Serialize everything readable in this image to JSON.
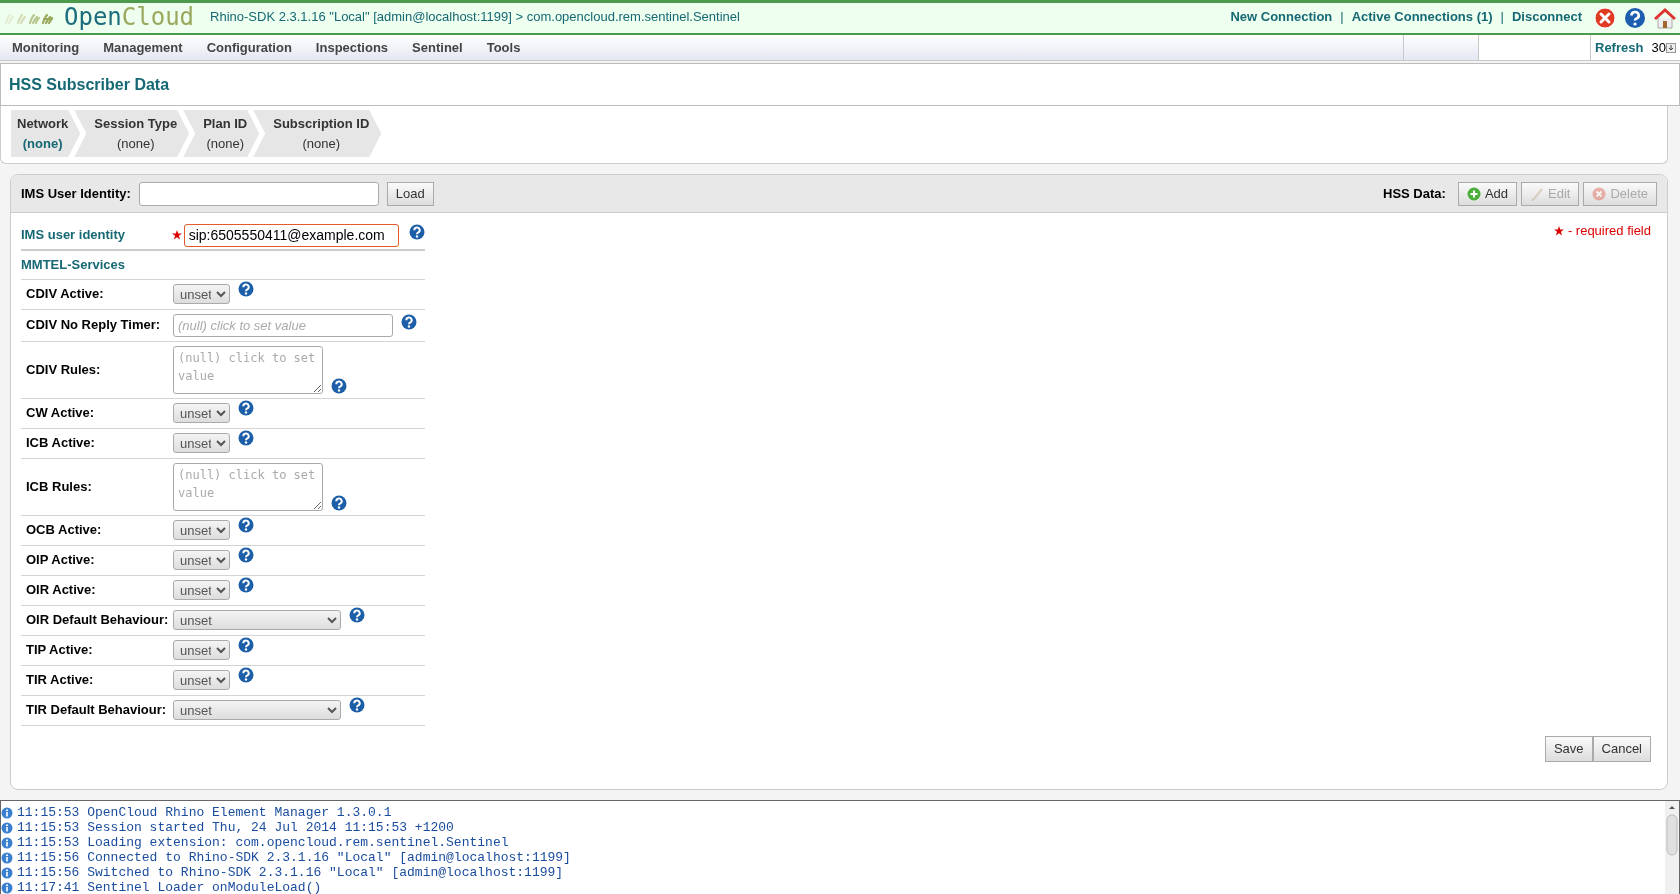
{
  "header": {
    "logo": {
      "part1": "Open",
      "part2": "Cloud"
    },
    "context": "Rhino-SDK 2.3.1.16 \"Local\" [admin@localhost:1199] > com.opencloud.rem.sentinel.Sentinel",
    "links": [
      "New Connection",
      "Active Connections (1)",
      "Disconnect"
    ],
    "separators": [
      "|",
      "|"
    ]
  },
  "menu": [
    "Monitoring",
    "Management",
    "Configuration",
    "Inspections",
    "Sentinel",
    "Tools"
  ],
  "refresh": {
    "label": "Refresh",
    "interval": "30"
  },
  "page_title": "HSS Subscriber Data",
  "breadcrumb": [
    {
      "title": "Network",
      "value": "(none)",
      "selected": true
    },
    {
      "title": "Session Type",
      "value": "(none)",
      "selected": false
    },
    {
      "title": "Plan ID",
      "value": "(none)",
      "selected": false
    },
    {
      "title": "Subscription ID",
      "value": "(none)",
      "selected": false
    }
  ],
  "lookup": {
    "label": "IMS User Identity:",
    "button": "Load"
  },
  "hss_data": {
    "label": "HSS Data:",
    "buttons": [
      {
        "label": "Add",
        "kind": "add",
        "disabled": false
      },
      {
        "label": "Edit",
        "kind": "edit",
        "disabled": true
      },
      {
        "label": "Delete",
        "kind": "delete",
        "disabled": true
      }
    ]
  },
  "required_note": "- required field",
  "identity": {
    "label": "IMS user identity",
    "value": "sip:6505550411@example.com",
    "required": true
  },
  "section": "MMTEL-Services",
  "fields": [
    {
      "label": "CDIV Active:",
      "kind": "select",
      "value": "unset"
    },
    {
      "label": "CDIV No Reply Timer:",
      "kind": "text",
      "placeholder": "(null) click to set value"
    },
    {
      "label": "CDIV Rules:",
      "kind": "textarea",
      "placeholder": "(null) click to set value"
    },
    {
      "label": "CW Active:",
      "kind": "select",
      "value": "unset"
    },
    {
      "label": "ICB Active:",
      "kind": "select",
      "value": "unset"
    },
    {
      "label": "ICB Rules:",
      "kind": "textarea",
      "placeholder": "(null) click to set value"
    },
    {
      "label": "OCB Active:",
      "kind": "select",
      "value": "unset"
    },
    {
      "label": "OIP Active:",
      "kind": "select",
      "value": "unset"
    },
    {
      "label": "OIR Active:",
      "kind": "select",
      "value": "unset"
    },
    {
      "label": "OIR Default Behaviour:",
      "kind": "wideselect",
      "value": "unset"
    },
    {
      "label": "TIP Active:",
      "kind": "select",
      "value": "unset"
    },
    {
      "label": "TIR Active:",
      "kind": "select",
      "value": "unset"
    },
    {
      "label": "TIR Default Behaviour:",
      "kind": "wideselect",
      "value": "unset"
    }
  ],
  "actions": [
    "Save",
    "Cancel"
  ],
  "log": [
    "11:15:53 OpenCloud Rhino Element Manager 1.3.0.1",
    "11:15:53 Session started Thu, 24 Jul 2014 11:15:53 +1200",
    "11:15:53 Loading extension: com.opencloud.rem.sentinel.Sentinel",
    "11:15:56 Connected to Rhino-SDK 2.3.1.16 \"Local\" [admin@localhost:1199]",
    "11:15:56 Switched to Rhino-SDK 2.3.1.16 \"Local\" [admin@localhost:1199]",
    "11:17:41 Sentinel Loader onModuleLoad()"
  ]
}
